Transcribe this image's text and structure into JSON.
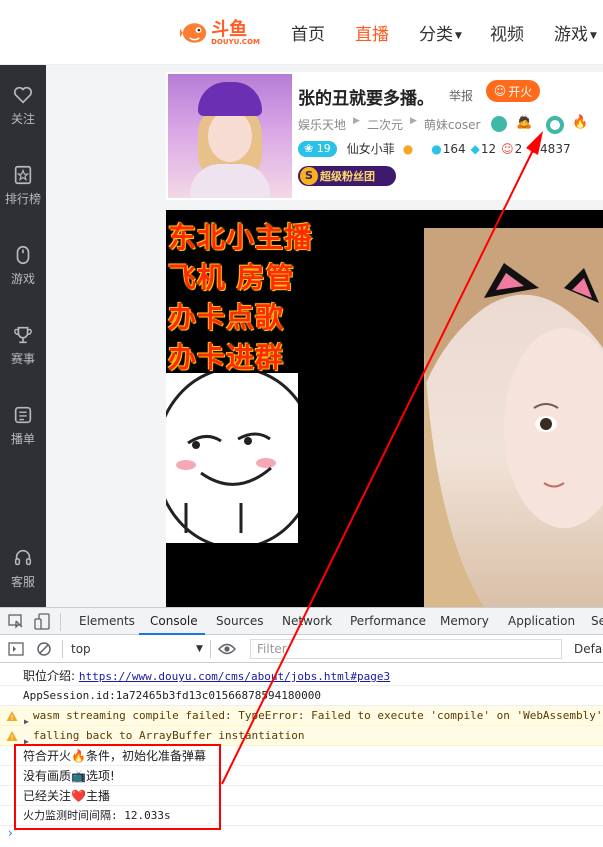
{
  "header": {
    "logo_cn": "斗鱼",
    "logo_en": "DOUYU.COM",
    "nav": [
      "首页",
      "直播",
      "分类",
      "视频",
      "游戏"
    ]
  },
  "sidebar": {
    "items": [
      {
        "label": "关注",
        "icon": "heart-icon"
      },
      {
        "label": "排行榜",
        "icon": "rank-star-icon"
      },
      {
        "label": "游戏",
        "icon": "mouse-icon"
      },
      {
        "label": "赛事",
        "icon": "trophy-icon"
      },
      {
        "label": "播单",
        "icon": "list-icon"
      },
      {
        "label": "客服",
        "icon": "headset-icon"
      }
    ]
  },
  "room": {
    "title": "张的丑就要多播。",
    "report": "举报",
    "kaihuo": "开火",
    "crumbs": [
      "娱乐天地",
      "二次元",
      "萌妹coser"
    ],
    "level": "19",
    "anchor": "仙女小菲",
    "count1": "164",
    "count2": "12",
    "count3": "2",
    "count4": "4837",
    "fans_club": "超级粉丝团"
  },
  "video": {
    "lines": [
      "东北小主播",
      "飞机  房管",
      "办卡点歌",
      "办卡进群"
    ]
  },
  "devtools": {
    "tabs": [
      "Elements",
      "Console",
      "Sources",
      "Network",
      "Performance",
      "Memory",
      "Application",
      "Se"
    ],
    "context": "top",
    "filter_placeholder": "Filter",
    "levels": "Defau",
    "logs": [
      {
        "prefix": "职位介绍: ",
        "link": "https://www.douyu.com/cms/about/jobs.html#page3"
      },
      {
        "text": "AppSession.id:1a72465b3fd13c01566878594180000"
      },
      {
        "text": "wasm streaming compile failed: TypeError: Failed to execute 'compile' on 'WebAssembly'"
      },
      {
        "text": "falling back to ArrayBuffer instantiation"
      },
      {
        "text": "符合开火🔥条件，初始化准备弹幕"
      },
      {
        "text": "没有画质📺选项!"
      },
      {
        "text": "已经关注❤️主播"
      },
      {
        "text": "火力监测时间间隔: 12.033s"
      }
    ]
  },
  "colors": {
    "accent": "#ff5d23",
    "highlight": "#ff0000",
    "devtools_blue": "#1a73e8"
  }
}
